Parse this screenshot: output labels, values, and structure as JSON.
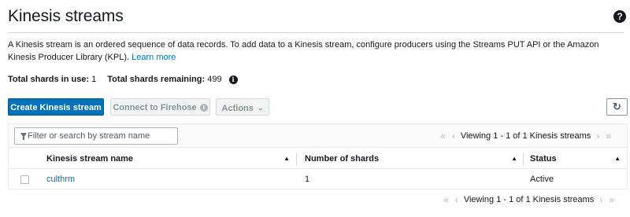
{
  "header": {
    "title": "Kinesis streams",
    "help_icon": "question-circle-icon"
  },
  "description": {
    "text": "A Kinesis stream is an ordered sequence of data records. To add data to a Kinesis stream, configure producers using the Streams PUT API or the Amazon Kinesis Producer Library (KPL).",
    "learn_more": "Learn more"
  },
  "shards": {
    "in_use_label": "Total shards in use:",
    "in_use_value": "1",
    "remaining_label": "Total shards remaining:",
    "remaining_value": "499",
    "info_icon": "info-circle-icon"
  },
  "toolbar": {
    "create_label": "Create Kinesis stream",
    "firehose_label": "Connect to Firehose",
    "actions_label": "Actions",
    "refresh_icon": "refresh-icon"
  },
  "table": {
    "search_placeholder": "Filter or search by stream name",
    "pager_text": "Viewing 1 - 1 of 1 Kinesis streams",
    "columns": [
      {
        "label": "Kinesis stream name"
      },
      {
        "label": "Number of shards"
      },
      {
        "label": "Status"
      }
    ],
    "rows": [
      {
        "name": "culthrm",
        "shards": "1",
        "status": "Active"
      }
    ]
  },
  "colors": {
    "primary": "#0073bb",
    "link": "#0073bb",
    "text": "#16191f",
    "disabled_text": "#879596"
  }
}
